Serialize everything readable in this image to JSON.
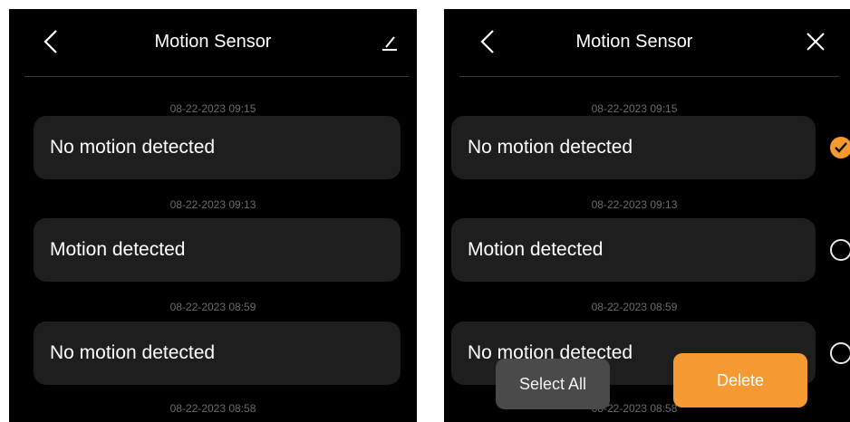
{
  "left": {
    "title": "Motion Sensor",
    "events": [
      {
        "timestamp": "08-22-2023 09:15",
        "message": "No motion detected"
      },
      {
        "timestamp": "08-22-2023 09:13",
        "message": "Motion detected"
      },
      {
        "timestamp": "08-22-2023 08:59",
        "message": "No motion detected"
      },
      {
        "timestamp": "08-22-2023 08:58"
      }
    ]
  },
  "right": {
    "title": "Motion Sensor",
    "events": [
      {
        "timestamp": "08-22-2023 09:15",
        "message": "No motion detected",
        "selected": true
      },
      {
        "timestamp": "08-22-2023 09:13",
        "message": "Motion detected",
        "selected": false
      },
      {
        "timestamp": "08-22-2023 08:59",
        "message": "No motion detected",
        "selected": false
      },
      {
        "timestamp": "08-22-2023 08:58"
      }
    ],
    "select_all_label": "Select All",
    "delete_label": "Delete"
  },
  "colors": {
    "accent": "#f59a33",
    "background": "#000000",
    "card": "#1e1e1e",
    "timestamp": "#6b6b6b"
  }
}
